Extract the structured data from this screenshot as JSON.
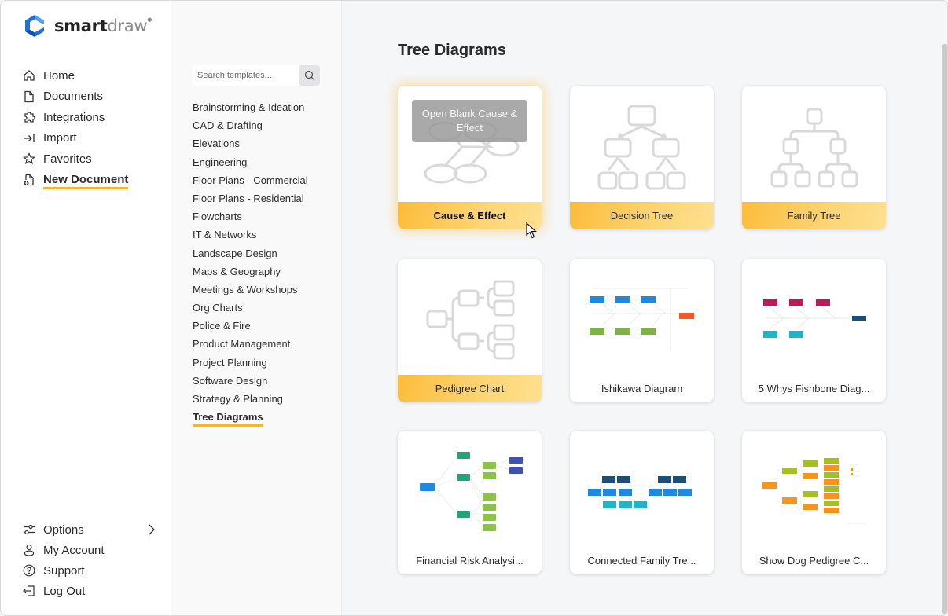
{
  "app": {
    "logo_primary": "smart",
    "logo_secondary": "draw",
    "brand_colors": {
      "logo_blue": "#1f6fd8",
      "accent_gold": "#f7b52a"
    }
  },
  "nav": {
    "items": [
      {
        "label": "Home",
        "icon": "home-icon"
      },
      {
        "label": "Documents",
        "icon": "document-icon"
      },
      {
        "label": "Integrations",
        "icon": "puzzle-icon"
      },
      {
        "label": "Import",
        "icon": "import-icon"
      },
      {
        "label": "Favorites",
        "icon": "star-icon"
      },
      {
        "label": "New Document",
        "icon": "new-document-icon",
        "active": true
      }
    ],
    "bottom": [
      {
        "label": "Options",
        "icon": "sliders-icon",
        "has_submenu": true
      },
      {
        "label": "My Account",
        "icon": "user-icon"
      },
      {
        "label": "Support",
        "icon": "help-icon"
      },
      {
        "label": "Log Out",
        "icon": "logout-icon"
      }
    ]
  },
  "categories": {
    "search_placeholder": "Search templates...",
    "items": [
      "Brainstorming & Ideation",
      "CAD & Drafting",
      "Elevations",
      "Engineering",
      "Floor Plans - Commercial",
      "Floor Plans - Residential",
      "Flowcharts",
      "IT & Networks",
      "Landscape Design",
      "Maps & Geography",
      "Meetings & Workshops",
      "Org Charts",
      "Police & Fire",
      "Product Management",
      "Project Planning",
      "Software Design",
      "Strategy & Planning",
      "Tree Diagrams"
    ],
    "active": "Tree Diagrams"
  },
  "main": {
    "title": "Tree Diagrams",
    "cards": [
      {
        "label": "Cause & Effect",
        "type": "blank",
        "hover_text": "Open Blank Cause & Effect",
        "hovered": true
      },
      {
        "label": "Decision Tree",
        "type": "blank"
      },
      {
        "label": "Family Tree",
        "type": "blank"
      },
      {
        "label": "Pedigree Chart",
        "type": "blank"
      },
      {
        "label": "Ishikawa Diagram",
        "type": "template"
      },
      {
        "label": "5 Whys Fishbone Diag...",
        "type": "template"
      },
      {
        "label": "Financial Risk Analysi...",
        "type": "template"
      },
      {
        "label": "Connected Family Tre...",
        "type": "template"
      },
      {
        "label": "Show Dog Pedigree C...",
        "type": "template"
      }
    ]
  }
}
